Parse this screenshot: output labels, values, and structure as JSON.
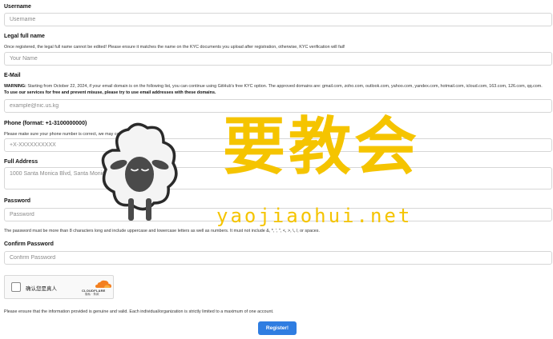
{
  "username": {
    "label": "Username",
    "placeholder": "Username"
  },
  "legal_name": {
    "label": "Legal full name",
    "help": "Once registered, the legal full name cannot be edited! Please ensure it matches the name on the KYC documents you upload after registration, otherwise, KYC verification will fail!",
    "placeholder": "Your Name"
  },
  "email": {
    "label": "E-Mail",
    "warning_prefix": "WARNING:",
    "help": " Starting from October 22, 2024, if your email domain is on the following list, you can continue using GitHub's free KYC option. The approved domains are: gmail.com, zoho.com, outlook.com, yahoo.com, yandex.com, hotmail.com, icloud.com, 163.com, 126.com, qq.com.",
    "help_bold": " To use our services for free and prevent misuse, please try to use email addresses with these domains.",
    "placeholder": "example@nic.us.kg"
  },
  "phone": {
    "label": "Phone (format: +1-3100000000)",
    "help": "Please make sure your phone number is correct, we may contact you via SMS.",
    "placeholder": "+X-XXXXXXXXXX"
  },
  "address": {
    "label": "Full Address",
    "placeholder": "1000 Santa Monica Blvd, Santa Monica, CA 90401, United States"
  },
  "password": {
    "label": "Password",
    "placeholder": "Password",
    "help": "The password must be more than 8 characters long and include uppercase and lowercase letters as well as numbers. It must not include &, *, ', \", <, >, \\, /, or spaces."
  },
  "confirm_password": {
    "label": "Confirm Password",
    "placeholder": "Confirm Password"
  },
  "captcha": {
    "label": "确认您是真人",
    "brand": "CLOUDFLARE",
    "links": "隐私 · 条款"
  },
  "notice": "Please ensure that the information provided is genuine and valid. Each individual/organization is strictly limited to a maximum of one account.",
  "submit_label": "Register!",
  "watermark": {
    "chinese": "要教会",
    "latin": "yaojiaohui.net"
  },
  "colors": {
    "accent": "#2f7de1",
    "watermark": "#f5c400",
    "cloudflare_orange": "#f38020"
  }
}
